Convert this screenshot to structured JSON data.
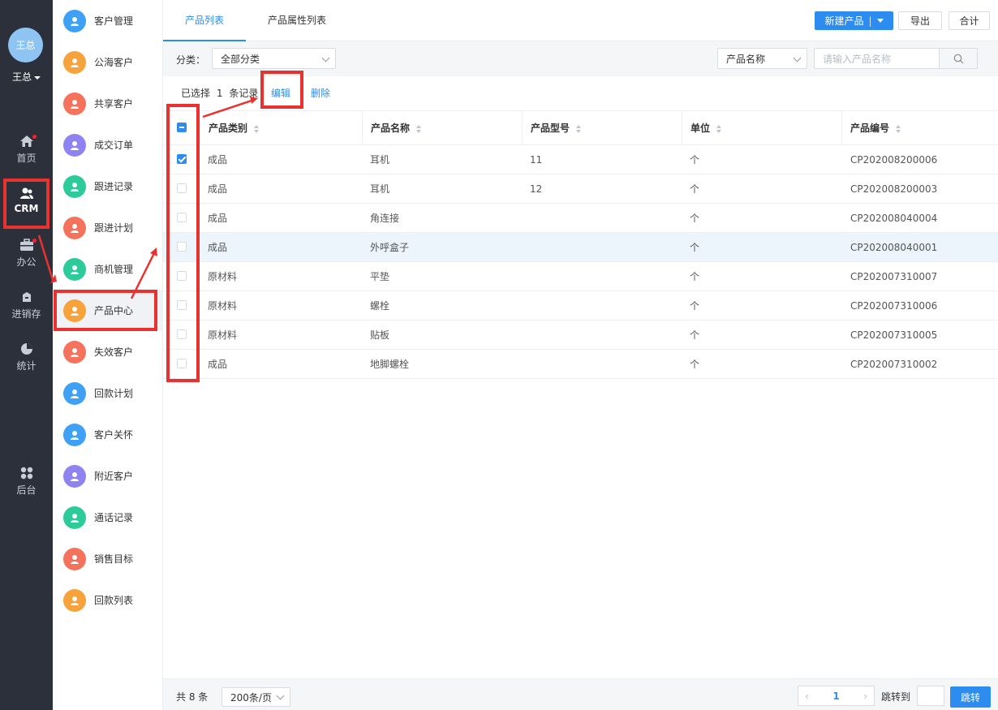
{
  "user": {
    "avatar_text": "王总",
    "name": "王总"
  },
  "nav": [
    {
      "label": "首页",
      "icon": "home-icon"
    },
    {
      "label": "CRM",
      "icon": "users-icon"
    },
    {
      "label": "办公",
      "icon": "briefcase-icon"
    },
    {
      "label": "进销存",
      "icon": "box-icon"
    },
    {
      "label": "统计",
      "icon": "pie-chart-icon"
    },
    {
      "label": "后台",
      "icon": "grid-icon"
    }
  ],
  "menu": [
    {
      "label": "客户管理",
      "color": "#3fa1f5"
    },
    {
      "label": "公海客户",
      "color": "#f7a23b"
    },
    {
      "label": "共享客户",
      "color": "#f5735c"
    },
    {
      "label": "成交订单",
      "color": "#8f83f2"
    },
    {
      "label": "跟进记录",
      "color": "#2dcb9a"
    },
    {
      "label": "跟进计划",
      "color": "#f5735c"
    },
    {
      "label": "商机管理",
      "color": "#2dcb9a"
    },
    {
      "label": "产品中心",
      "color": "#f7a23b"
    },
    {
      "label": "失效客户",
      "color": "#f5735c"
    },
    {
      "label": "回款计划",
      "color": "#3fa1f5"
    },
    {
      "label": "客户关怀",
      "color": "#3fa1f5"
    },
    {
      "label": "附近客户",
      "color": "#8f83f2"
    },
    {
      "label": "通话记录",
      "color": "#2dcb9a"
    },
    {
      "label": "销售目标",
      "color": "#f5735c"
    },
    {
      "label": "回款列表",
      "color": "#f7a23b"
    }
  ],
  "tabs": [
    "产品列表",
    "产品属性列表"
  ],
  "toolbar": {
    "new_label": "新建产品",
    "export_label": "导出",
    "sum_label": "合计"
  },
  "filter": {
    "category_label": "分类：",
    "category_value": "全部分类",
    "search_field": "产品名称",
    "search_placeholder": "请输入产品名称"
  },
  "selection": {
    "prefix": "已选择",
    "count": "1",
    "suffix": "条记录",
    "edit": "编辑",
    "delete": "删除"
  },
  "columns": [
    "产品类别",
    "产品名称",
    "产品型号",
    "单位",
    "产品编号"
  ],
  "rows": [
    {
      "category": "成品",
      "name": "耳机",
      "model": "11",
      "unit": "个",
      "code": "CP202008200006",
      "checked": true
    },
    {
      "category": "成品",
      "name": "耳机",
      "model": "12",
      "unit": "个",
      "code": "CP202008200003",
      "checked": false
    },
    {
      "category": "成品",
      "name": "角连接",
      "model": "",
      "unit": "个",
      "code": "CP202008040004",
      "checked": false
    },
    {
      "category": "成品",
      "name": "外呼盒子",
      "model": "",
      "unit": "个",
      "code": "CP202008040001",
      "checked": false
    },
    {
      "category": "原材料",
      "name": "平垫",
      "model": "",
      "unit": "个",
      "code": "CP202007310007",
      "checked": false
    },
    {
      "category": "原材料",
      "name": "螺栓",
      "model": "",
      "unit": "个",
      "code": "CP202007310006",
      "checked": false
    },
    {
      "category": "原材料",
      "name": "贴板",
      "model": "",
      "unit": "个",
      "code": "CP202007310005",
      "checked": false
    },
    {
      "category": "成品",
      "name": "地脚螺栓",
      "model": "",
      "unit": "个",
      "code": "CP202007310002",
      "checked": false
    }
  ],
  "footer": {
    "total": "共 8 条",
    "page_size": "200条/页",
    "current_page": "1",
    "jump_label": "跳转到",
    "jump_button": "跳转"
  },
  "colors": {
    "accent": "#2d8cf0",
    "nav_bg": "#2b303b",
    "annotation": "#e8322f"
  }
}
